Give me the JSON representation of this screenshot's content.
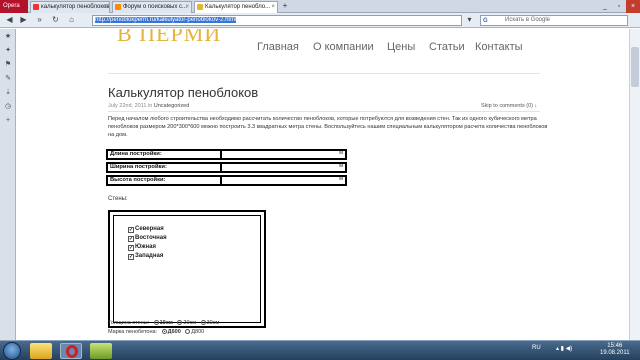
{
  "browser": {
    "menu_label": "Opera",
    "tabs": [
      {
        "label": "калькулятор пеноблоков"
      },
      {
        "label": "Форум о поисковых с..."
      },
      {
        "label": "Калькулятор пенобло..."
      }
    ],
    "new_tab": "+",
    "url": "http://penoblokperm.ru/kalkulyator-penoblokov-2.html",
    "search_placeholder": "Искать в Google",
    "search_engine": "G"
  },
  "site": {
    "logo": "В ПЕРМИ",
    "nav": [
      "Главная",
      "О компании",
      "Цены",
      "Статьи",
      "Контакты"
    ]
  },
  "post": {
    "title": "Калькулятор пеноблоков",
    "date": "July 22nd, 2011",
    "in_label": "in",
    "category": "Uncategorized",
    "skip": "Skip to comments (0) ↓",
    "intro": "Перед началом любого строительства необходимо рассчитать количество пеноблоков, которые потребуются для возведения стен. Так из одного кубического метра пеноблоков размером 200*300*600 можно построить 3.3 квадратных метра стены. Воспользуйтесь нашим специальным калькулятором расчета количества пеноблоков на дом."
  },
  "calculator": {
    "fields": [
      {
        "label": "Длина постройки:",
        "unit": "м"
      },
      {
        "label": "Ширина постройки:",
        "unit": "м"
      },
      {
        "label": "Высота постройки:",
        "unit": "м"
      }
    ],
    "walls_title": "Стены:",
    "walls": [
      {
        "label": "Северная",
        "checked": true
      },
      {
        "label": "Восточная",
        "checked": true
      },
      {
        "label": "Южная",
        "checked": true
      },
      {
        "label": "Западная",
        "checked": true
      }
    ],
    "thickness_label": "Толщина стены:",
    "thickness_options": [
      "10см",
      "20см",
      "30см"
    ],
    "brand_label": "Марка пенобетона:",
    "brand_options": [
      "Д600",
      "Д800"
    ]
  },
  "taskbar": {
    "lang": "RU",
    "time": "15:46",
    "date": "19.08.2011"
  }
}
